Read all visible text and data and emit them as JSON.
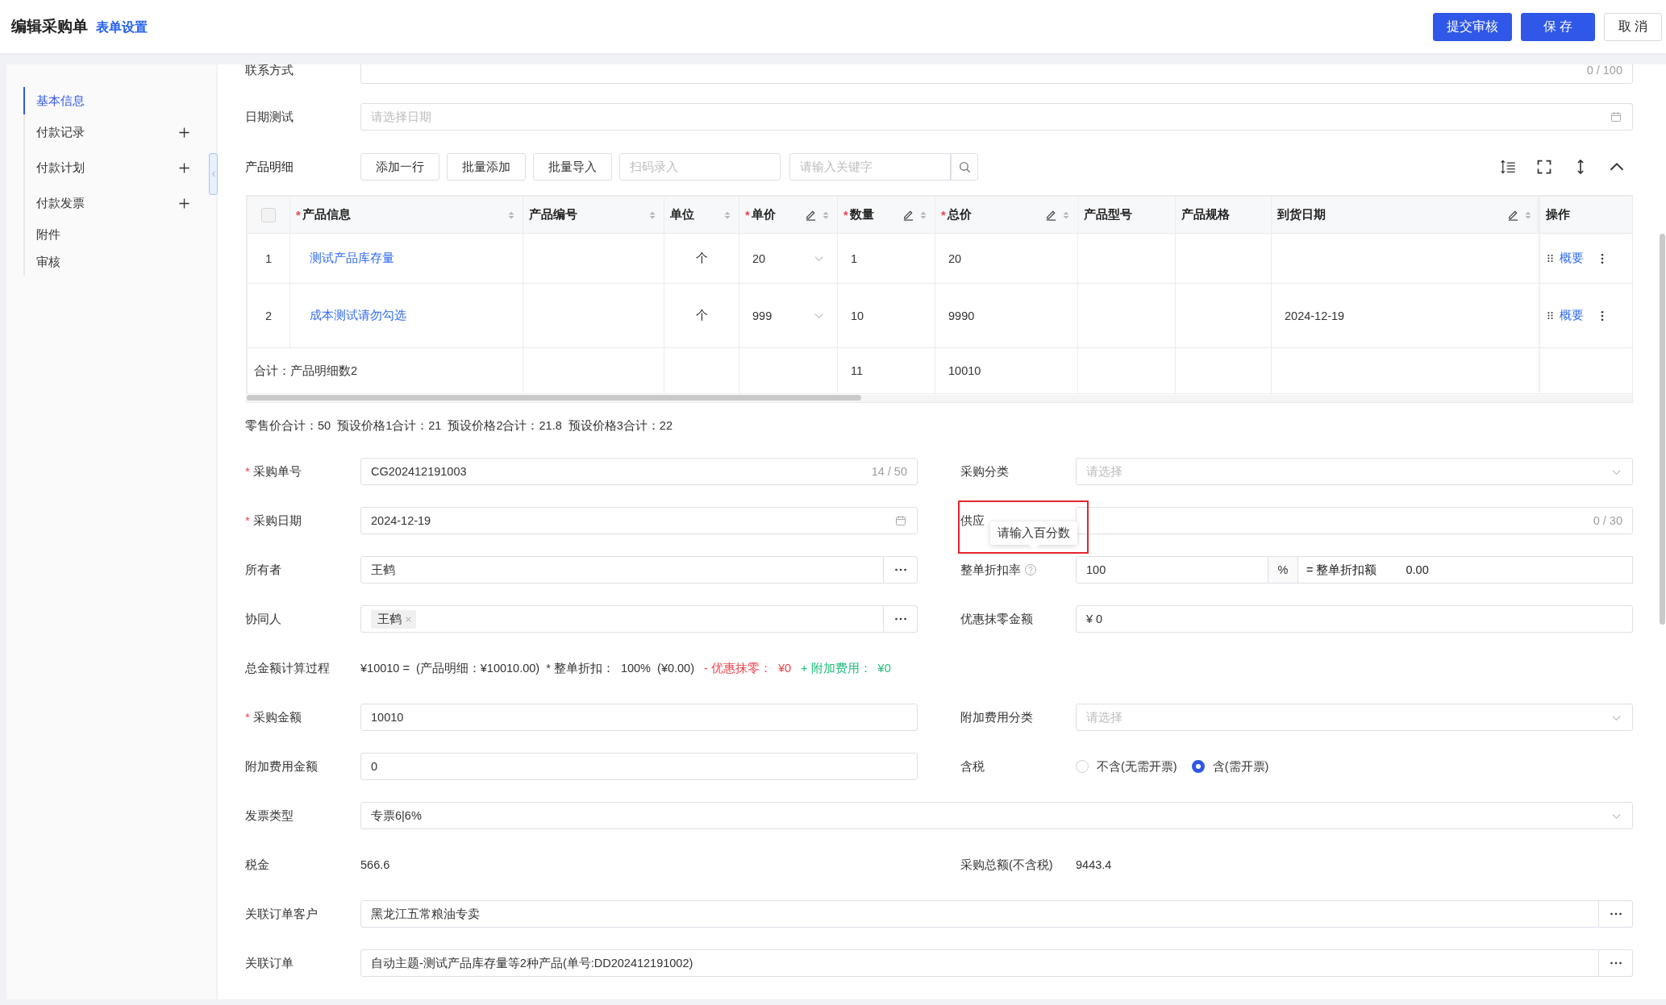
{
  "header": {
    "title": "编辑采购单",
    "settings_link": "表单设置",
    "buttons": [
      {
        "label": "提交审核",
        "kind": "primary"
      },
      {
        "label": "保 存",
        "kind": "primary"
      },
      {
        "label": "取 消",
        "kind": "default"
      }
    ]
  },
  "sidebar": {
    "items": [
      {
        "label": "基本信息",
        "selected": true,
        "addable": false
      },
      {
        "label": "付款记录",
        "selected": false,
        "addable": true
      },
      {
        "label": "付款计划",
        "selected": false,
        "addable": true
      },
      {
        "label": "付款发票",
        "selected": false,
        "addable": true
      },
      {
        "label": "附件",
        "selected": false,
        "addable": false
      },
      {
        "label": "审核",
        "selected": false,
        "addable": false
      }
    ]
  },
  "top_fields": [
    {
      "label": "联系方式",
      "kind": "text",
      "count": "0 / 100"
    },
    {
      "label": "日期测试",
      "kind": "date",
      "placeholder": "请选择日期"
    }
  ],
  "product_toolbar": {
    "label": "产品明细",
    "buttons": [
      "添加一行",
      "批量添加",
      "批量导入"
    ],
    "scan_placeholder": "扫码录入",
    "search_placeholder": "请输入关键字"
  },
  "table": {
    "select_all_checked": false,
    "columns": [
      {
        "label": "产品信息",
        "mark": "*",
        "kind": "link",
        "editable": false,
        "sortable": true
      },
      {
        "label": "产品编号",
        "kind": "text",
        "editable": false,
        "sortable": true
      },
      {
        "label": "单位",
        "kind": "center",
        "editable": false,
        "sortable": true
      },
      {
        "label": "单价",
        "mark": "*",
        "kind": "select",
        "editable": true,
        "sortable": true
      },
      {
        "label": "数量",
        "mark": "*",
        "kind": "text",
        "editable": true,
        "sortable": true
      },
      {
        "label": "总价",
        "mark": "*",
        "kind": "text",
        "editable": true,
        "sortable": true
      },
      {
        "label": "产品型号",
        "kind": "text",
        "editable": false,
        "sortable": false
      },
      {
        "label": "产品规格",
        "kind": "text",
        "editable": false,
        "sortable": false
      },
      {
        "label": "到货日期",
        "kind": "text",
        "editable": true,
        "sortable": true
      },
      {
        "label": "操作",
        "kind": "actions",
        "editable": false,
        "sortable": false
      }
    ],
    "rows": [
      {
        "index": "1",
        "cells": [
          "测试产品库存量",
          null,
          "个",
          "20",
          "1",
          "20",
          null,
          null,
          null,
          "概要"
        ]
      },
      {
        "index": "2",
        "cells": [
          "成本测试请勿勾选",
          null,
          "个",
          "999",
          "10",
          "9990",
          null,
          null,
          "2024-12-19",
          "概要"
        ]
      }
    ],
    "total": {
      "cells": [
        "合计：产品明细数2",
        null,
        null,
        null,
        "11",
        "10010",
        null,
        null,
        null,
        null
      ]
    }
  },
  "summary": "零售价合计：50  预设价格1合计：21  预设价格2合计：21.8  预设价格3合计：22",
  "form": {
    "rows": [
      {
        "fields": [
          {
            "label": "采购单号",
            "mark": "*",
            "kind": "text",
            "value": "CG202412191003",
            "count": "14 / 50"
          },
          {
            "label": "采购分类",
            "kind": "select",
            "placeholder": "请选择"
          }
        ]
      },
      {
        "fields": [
          {
            "label": "采购日期",
            "mark": "*",
            "kind": "date",
            "value": "2024-12-19"
          },
          {
            "label": "供应",
            "kind": "text",
            "count": "0 / 30",
            "highlighted": true
          }
        ]
      },
      {
        "fields": [
          {
            "label": "所有者",
            "kind": "picker",
            "value": "王鹤"
          },
          {
            "label": "整单折扣率",
            "kind": "discount",
            "help": true,
            "tooltip": "请输入百分数",
            "value": "100",
            "unit": "%",
            "result_label": "= 整单折扣额",
            "result": "0.00"
          }
        ]
      },
      {
        "fields": [
          {
            "label": "协同人",
            "kind": "tags",
            "tags": [
              "王鹤"
            ]
          },
          {
            "label": "优惠抹零金额",
            "kind": "text",
            "value": "¥ 0"
          }
        ]
      },
      {
        "fields": [
          {
            "label": "总金额计算过程",
            "kind": "formula",
            "parts": [
              {
                "text": "¥10010 =  (产品明细：¥10010.00)  * 整单折扣：  100%  (¥0.00)",
                "color": "#333333"
              },
              {
                "text": "- 优惠抹零：  ¥0",
                "color": "#f0424b"
              },
              {
                "text": "+ 附加费用：  ¥0",
                "color": "#1fbf7a"
              }
            ]
          }
        ]
      },
      {
        "fields": [
          {
            "label": "采购金额",
            "mark": "*",
            "kind": "text",
            "value": "10010"
          },
          {
            "label": "附加费用分类",
            "kind": "select",
            "placeholder": "请选择"
          }
        ]
      },
      {
        "fields": [
          {
            "label": "附加费用金额",
            "kind": "text",
            "value": "0"
          },
          {
            "label": "含税",
            "kind": "radio",
            "options": [
              {
                "label": "不含(无需开票)",
                "selected": false
              },
              {
                "label": "含(需开票)",
                "selected": true
              }
            ]
          }
        ]
      },
      {
        "fields": [
          {
            "label": "发票类型",
            "kind": "select",
            "value": "专票6|6%"
          }
        ]
      },
      {
        "fields": [
          {
            "label": "税金",
            "kind": "static",
            "value": "566.6"
          },
          {
            "label": "采购总额(不含税)",
            "kind": "static",
            "value": "9443.4"
          }
        ]
      },
      {
        "fields": [
          {
            "label": "关联订单客户",
            "kind": "picker",
            "value": "黑龙江五常粮油专卖"
          }
        ]
      },
      {
        "fields": [
          {
            "label": "关联订单",
            "kind": "picker",
            "value": "自动主题-测试产品库存量等2种产品(单号:DD202412191002)"
          }
        ]
      }
    ]
  }
}
